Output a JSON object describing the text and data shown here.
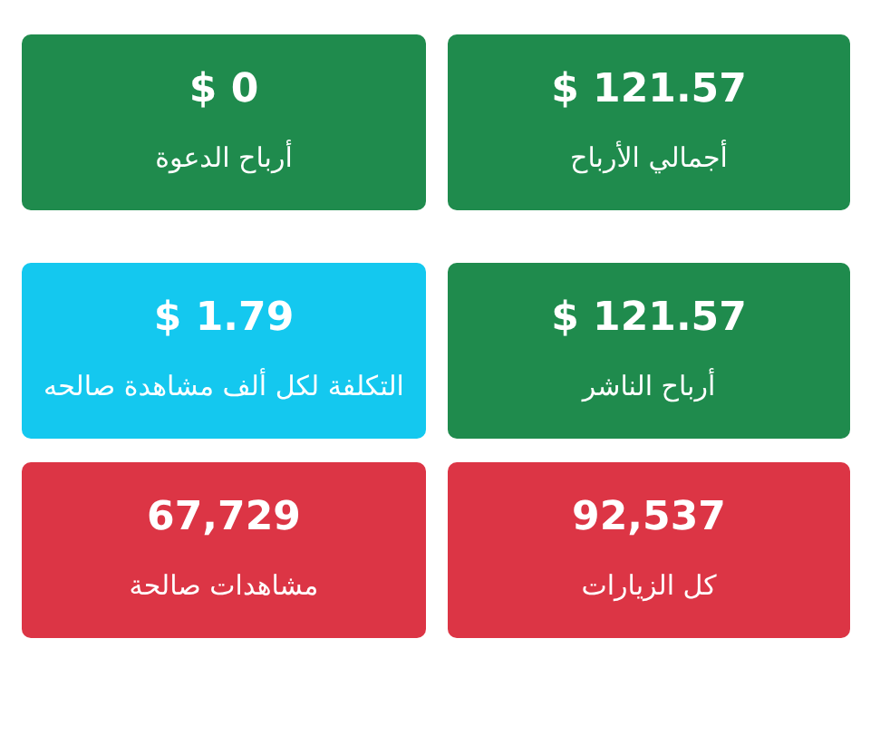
{
  "cards": [
    {
      "value": "$ 121.57",
      "label": "أجمالي الأرباح",
      "color": "#1f8b4d"
    },
    {
      "value": "$ 0",
      "label": "أرباح الدعوة",
      "color": "#1f8b4d"
    },
    {
      "value": "$ 121.57",
      "label": "أرباح الناشر",
      "color": "#1f8b4d"
    },
    {
      "value": "$ 1.79",
      "label": "التكلفة لكل ألف مشاهدة صالحه",
      "color": "#14c8ef"
    },
    {
      "value": "92,537",
      "label": "كل الزيارات",
      "color": "#dc3545"
    },
    {
      "value": "67,729",
      "label": "مشاهدات صالحة",
      "color": "#dc3545"
    }
  ]
}
